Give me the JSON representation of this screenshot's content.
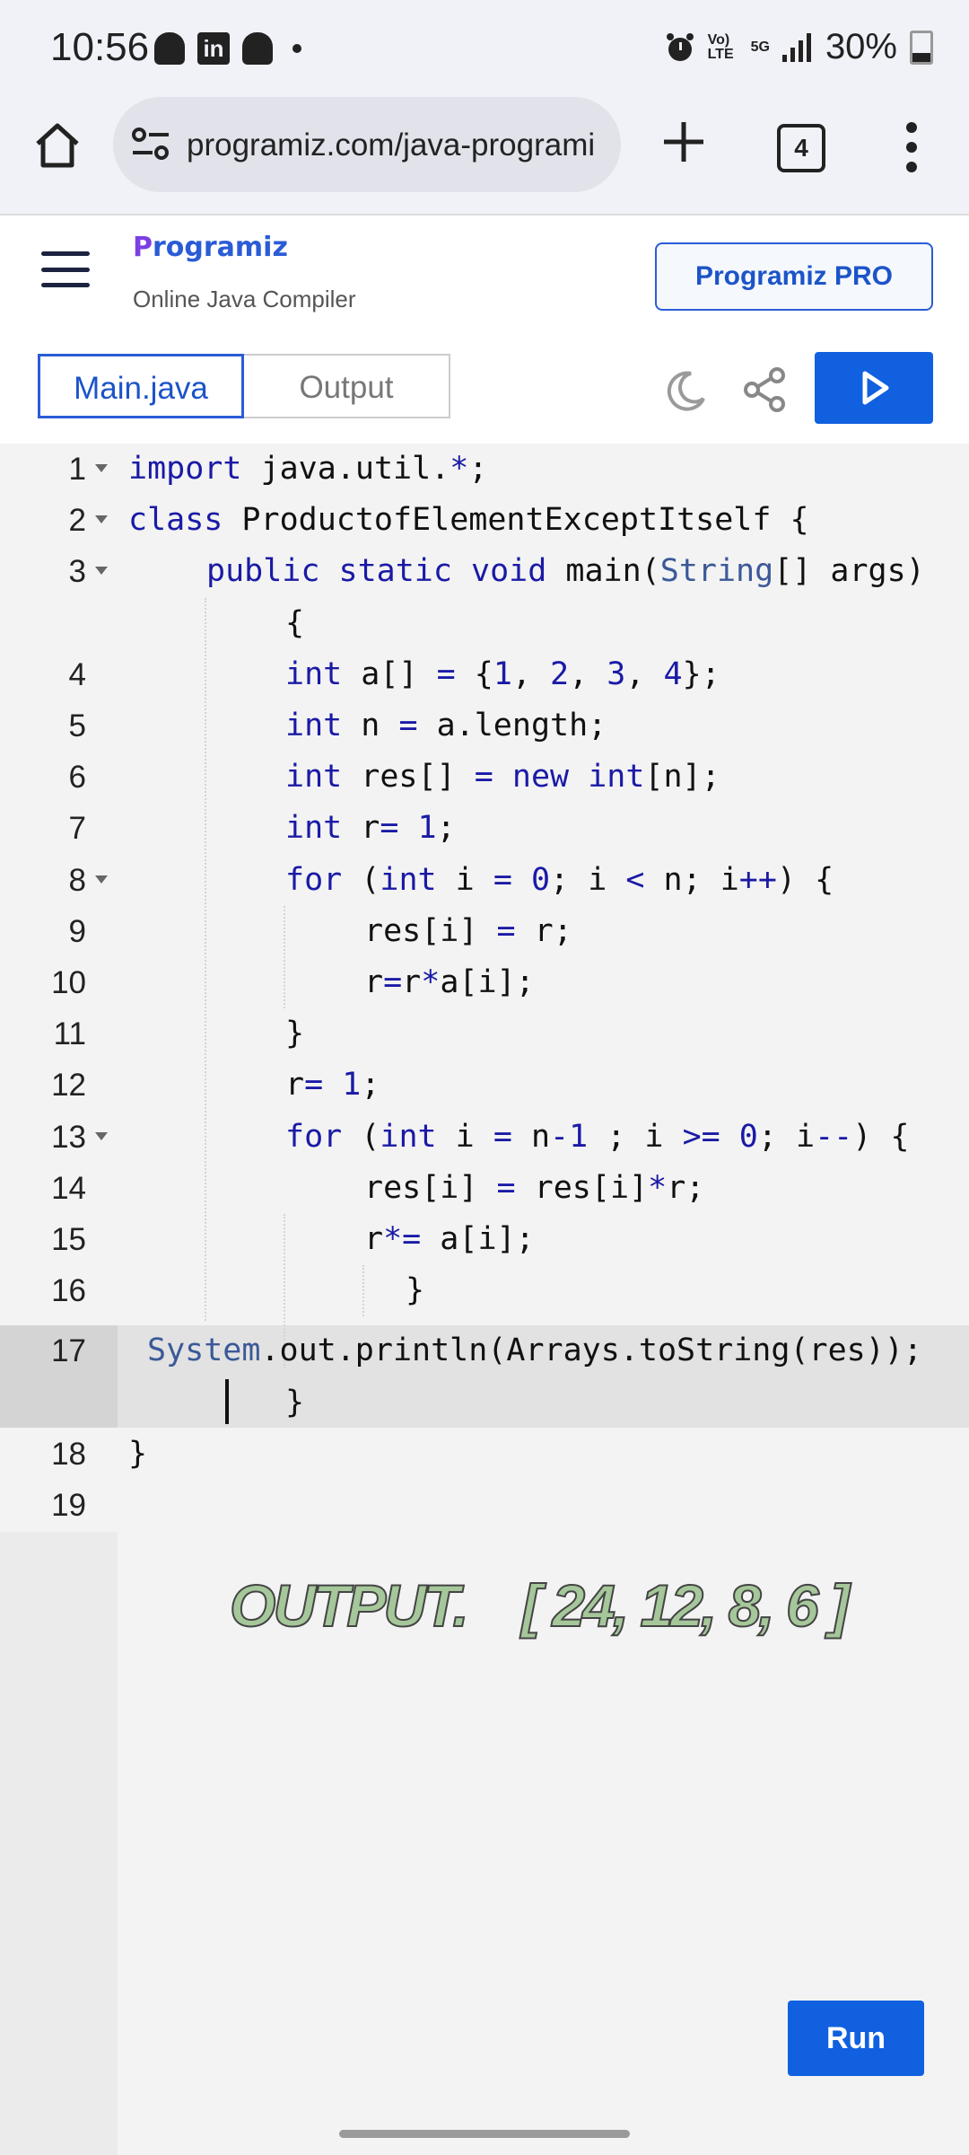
{
  "status_bar": {
    "time": "10:56",
    "network": "Vo) LTE",
    "five_g": "5G",
    "battery": "30%"
  },
  "browser": {
    "url": "programiz.com/java-programi",
    "tab_count": "4"
  },
  "site": {
    "logo_text": "rogramiz",
    "logo_first": "P",
    "subtitle": "Online Java Compiler",
    "pro_button": "Programiz PRO"
  },
  "toolbar": {
    "tab_main": "Main.java",
    "tab_output": "Output"
  },
  "editor": {
    "line_numbers": [
      "1",
      "2",
      "3",
      "4",
      "5",
      "6",
      "7",
      "8",
      "9",
      "10",
      "11",
      "12",
      "13",
      "14",
      "15",
      "16",
      "17",
      "18",
      "19"
    ],
    "code_lines": [
      "import java.util.*;",
      "class ProductofElementExceptItself {",
      "public static void main(String[] args)",
      "{",
      "int a[] = {1, 2, 3, 4};",
      "int n = a.length;",
      "int res[] = new int[n];",
      "int r= 1;",
      "for (int i = 0; i < n; i++) {",
      "res[i] = r;",
      "r=r*a[i];",
      "}",
      "r= 1;",
      "for (int i = n-1 ; i >= 0; i--) {",
      "res[i] = res[i]*r;",
      "r*= a[i];",
      "}",
      "System.out.println(Arrays.toString(res));",
      "}",
      "}"
    ],
    "output_note": "OUTPUT.    [ 24, 12, 8, 6 ]"
  },
  "run_button": "Run"
}
